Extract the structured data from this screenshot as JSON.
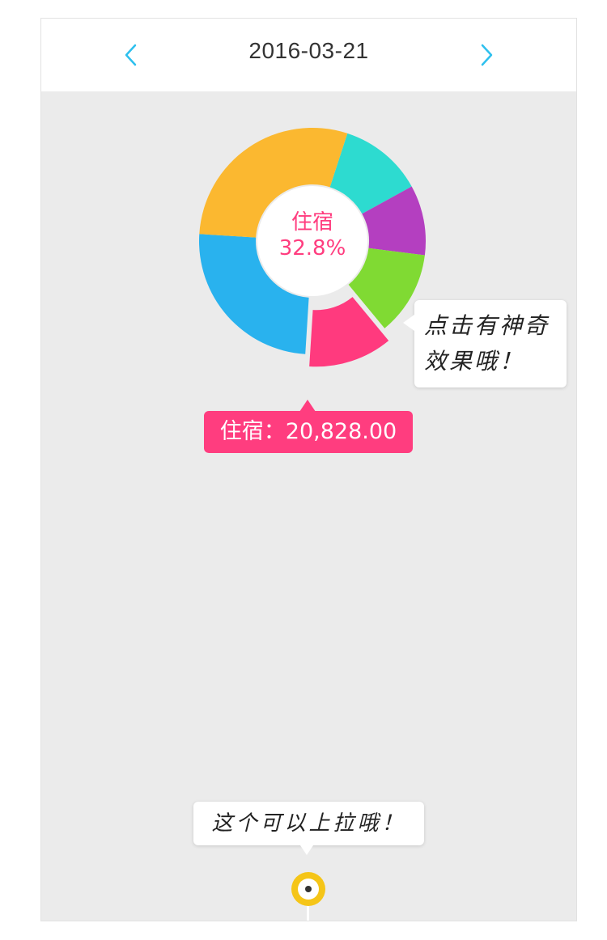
{
  "header": {
    "date": "2016-03-21",
    "prev_icon": "chevron-left-icon",
    "next_icon": "chevron-right-icon",
    "accent_color": "#2ec0ee"
  },
  "chart_data": {
    "type": "pie",
    "selected": "住宿",
    "selected_percent": "32.8%",
    "center_label": "住宿",
    "center_value": "32.8%",
    "slices": [
      {
        "color": "#2ddbd0",
        "share": 0.12
      },
      {
        "color": "#b43fc0",
        "share": 0.1
      },
      {
        "color": "#80da33",
        "share": 0.12
      },
      {
        "color": "#ff3a7e",
        "share": 0.12
      },
      {
        "color": "#29b2ee",
        "share": 0.25
      },
      {
        "color": "#fbb830",
        "share": 0.29
      }
    ]
  },
  "selected_tag": {
    "text": "住宿：20,828.00",
    "color": "#ff3d7f"
  },
  "tips": {
    "chart_tip": [
      "点击有神奇",
      "效果哦！"
    ],
    "pull_tip": "这个可以上拉哦！"
  },
  "pull_handle": {
    "color": "#f5c518"
  }
}
